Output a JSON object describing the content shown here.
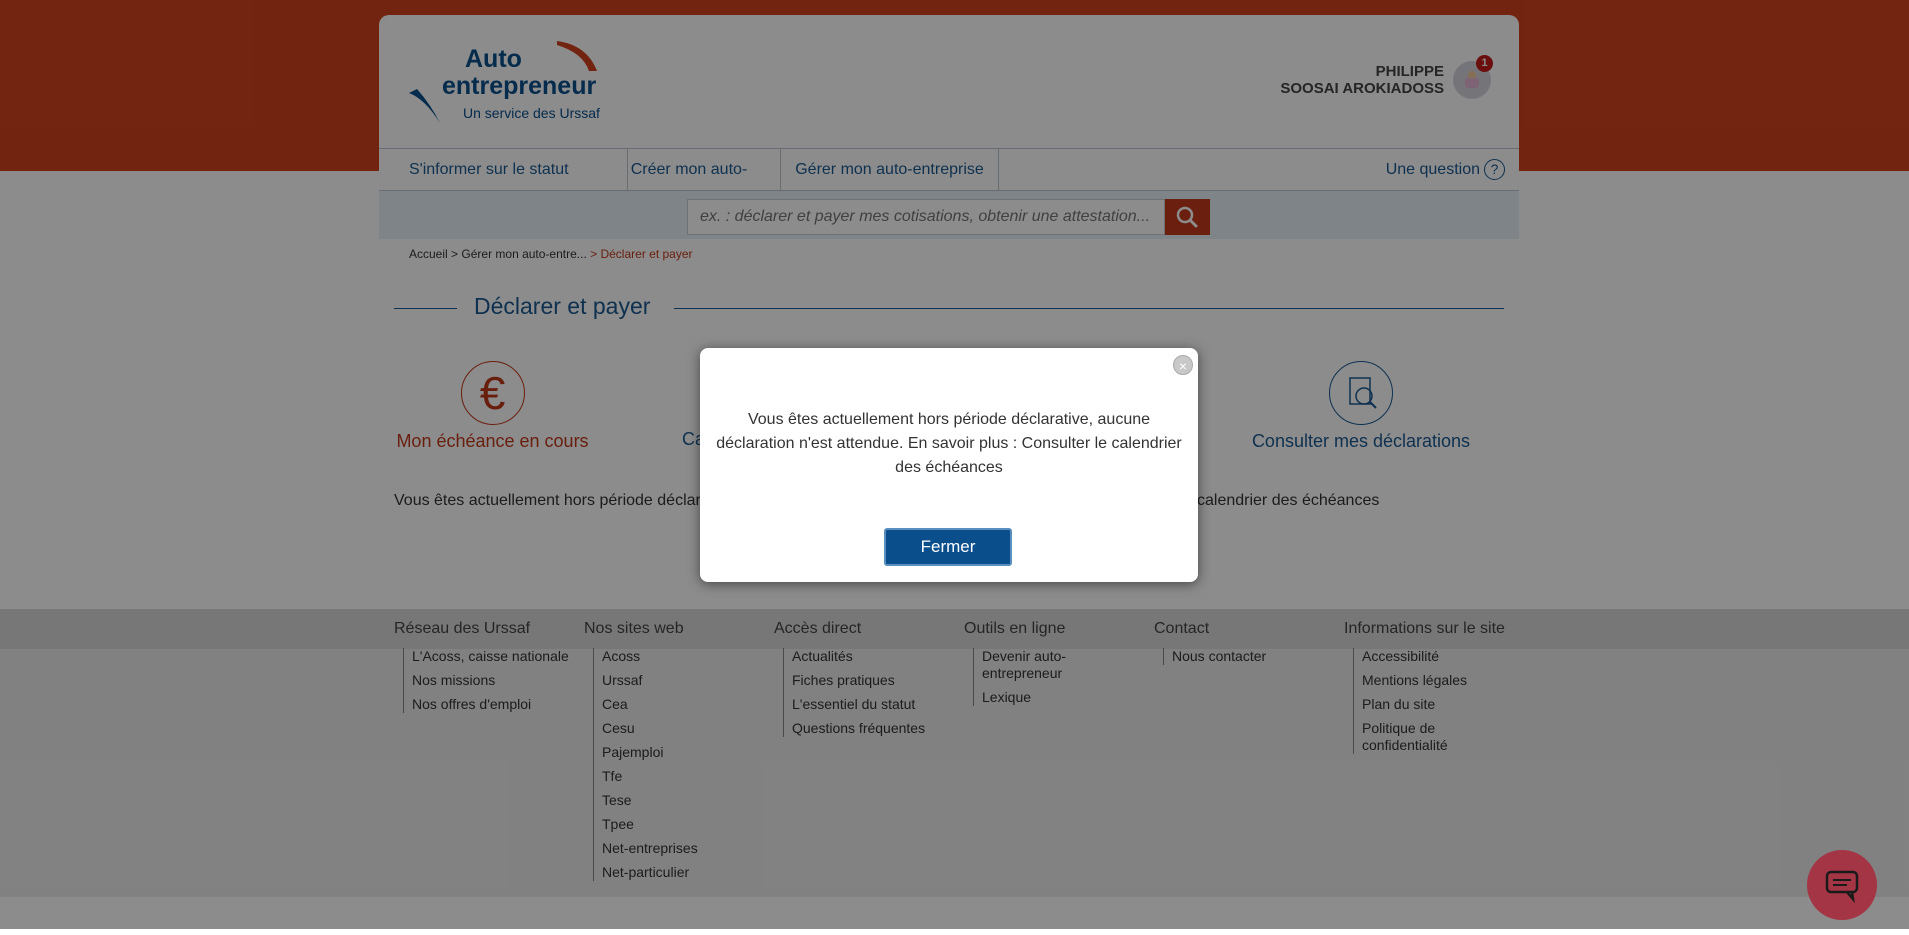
{
  "header": {
    "logo_line1": "Auto",
    "logo_line2": "entrepreneur",
    "logo_sub": "Un service des Urssaf",
    "user_first": "PHILIPPE",
    "user_last": "SOOSAI AROKIADOSS",
    "notif_count": "1"
  },
  "nav": {
    "items": [
      {
        "label": "S'informer sur le statut"
      },
      {
        "label": "Créer mon auto-entreprise"
      },
      {
        "label": "Gérer mon auto-entreprise"
      }
    ],
    "help_label": "Une question",
    "help_symbol": "?"
  },
  "search": {
    "placeholder": "ex. : déclarer et payer mes cotisations, obtenir une attestation..."
  },
  "breadcrumb": {
    "home": "Accueil",
    "sep": ">",
    "parent": "Gérer mon auto-entre...",
    "current": "> Déclarer et payer"
  },
  "main": {
    "title": "Déclarer et payer",
    "tiles": [
      {
        "label": "Mon échéance en cours",
        "symbol": "€",
        "color": "#c0391b"
      },
      {
        "label": "Ca",
        "color": "#1d5a92"
      },
      {
        "label": "Consulter mes déclarations",
        "color": "#1d5a92"
      }
    ],
    "intro_left": "Vous êtes actuellement hors période déclar",
    "intro_right": "calendrier des échéances"
  },
  "footer": {
    "columns": [
      {
        "title": "Réseau des Urssaf",
        "items": [
          "L'Acoss, caisse nationale",
          "Nos missions",
          "Nos offres d'emploi"
        ]
      },
      {
        "title": "Nos sites web",
        "items": [
          "Acoss",
          "Urssaf",
          "Cea",
          "Cesu",
          "Pajemploi",
          "Tfe",
          "Tese",
          "Tpee",
          "Net-entreprises",
          "Net-particulier"
        ]
      },
      {
        "title": "Accès direct",
        "items": [
          "Actualités",
          "Fiches pratiques",
          "L'essentiel du statut",
          "Questions fréquentes"
        ]
      },
      {
        "title": "Outils en ligne",
        "items": [
          "Devenir auto-entrepreneur",
          "Lexique"
        ]
      },
      {
        "title": "Contact",
        "items": [
          "Nous contacter"
        ]
      },
      {
        "title": "Informations sur le site",
        "items": [
          "Accessibilité",
          "Mentions légales",
          "Plan du site",
          "Politique de confidentialité"
        ]
      }
    ]
  },
  "modal": {
    "message": "Vous êtes actuellement hors période déclarative, aucune déclaration n'est attendue. En savoir plus : Consulter le calendrier des échéances",
    "close_button": "Fermer",
    "close_symbol": "×"
  },
  "colors": {
    "brand_orange": "#d2431f",
    "brand_blue": "#0a4f8c",
    "link_blue": "#1d5a92",
    "accent_red": "#c0391b"
  },
  "icons": [
    "search-icon",
    "help-icon",
    "euro-icon",
    "document-search-icon",
    "close-icon",
    "chat-icon",
    "user-avatar-icon"
  ]
}
